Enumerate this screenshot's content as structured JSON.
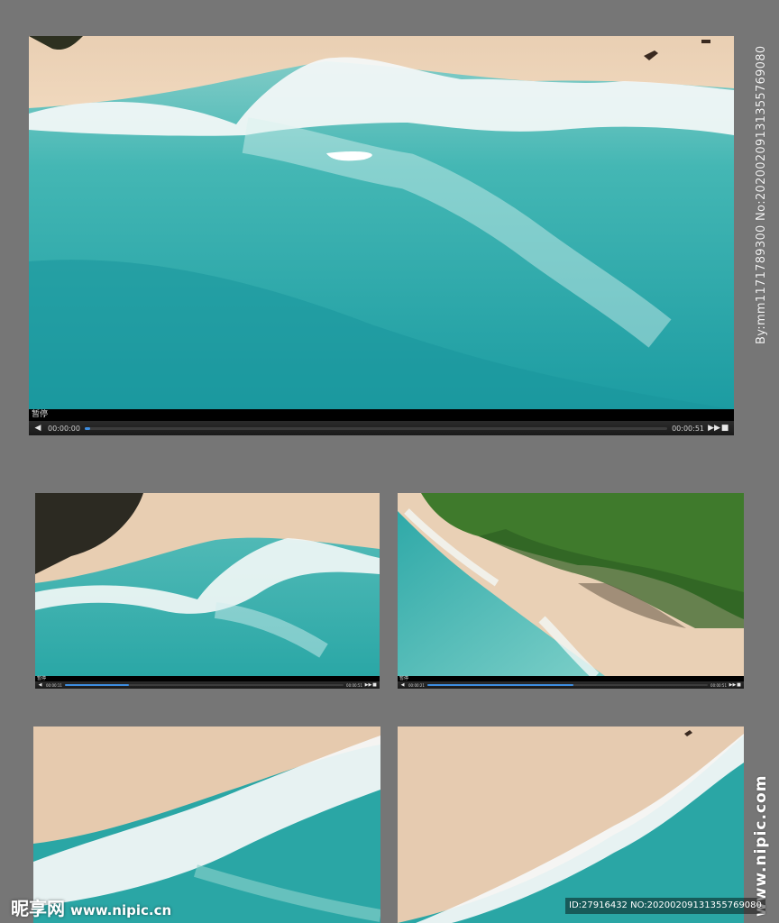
{
  "players": {
    "main": {
      "status_label": "暂停",
      "time_current": "00:00:00",
      "time_total": "00:00:51",
      "progress": 0.01,
      "prev_icon": "◀",
      "next_icon": "▶▶",
      "stop_icon": "■"
    },
    "a": {
      "status_label": "暂停",
      "time_current": "00:00:11",
      "time_total": "00:00:51",
      "progress": 0.23,
      "prev_icon": "◀",
      "next_icon": "▶▶",
      "stop_icon": "■"
    },
    "b": {
      "status_label": "暂停",
      "time_current": "00:00:21",
      "time_total": "00:00:51",
      "progress": 0.52,
      "prev_icon": "◀",
      "next_icon": "▶▶",
      "stop_icon": "■"
    }
  },
  "watermarks": {
    "vertical_right": "By:mm1171789300  No:20200209131355769080",
    "site_vertical": "www.nipic.com",
    "logo_brand": "昵享网",
    "logo_url": "www.nipic.cn",
    "id_badge": "ID:27916432 NO:20200209131355769080"
  },
  "colors": {
    "background": "#767676",
    "progress_fill": "#3d8de0",
    "sea_deep": "#1f9ea3",
    "sea_light": "#5fc7c3",
    "sand": "#e8cdb0",
    "foam": "#ffffff",
    "foliage": "#3f7a2c"
  }
}
